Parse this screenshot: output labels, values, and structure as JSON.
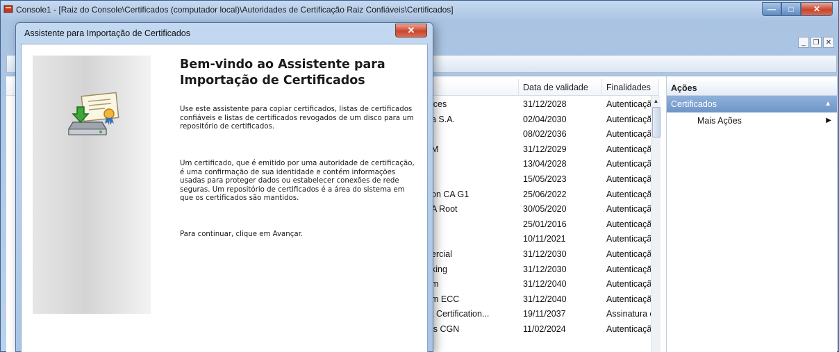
{
  "main_window": {
    "title": "Console1 - [Raiz do Console\\Certificados (computador local)\\Autoridades de Certificação Raiz Confiáveis\\Certificados]"
  },
  "list": {
    "columns": [
      "",
      "Data de validade",
      "Finalidades"
    ],
    "rows": [
      {
        "name": "ices",
        "date": "31/12/2028",
        "purpose": "Autenticaçã"
      },
      {
        "name": "a S.A.",
        "date": "02/04/2030",
        "purpose": "Autenticaçã"
      },
      {
        "name": "",
        "date": "08/02/2036",
        "purpose": "Autenticaçã"
      },
      {
        "name": "M",
        "date": "31/12/2029",
        "purpose": "Autenticaçã"
      },
      {
        "name": "",
        "date": "13/04/2028",
        "purpose": "Autenticaçã"
      },
      {
        "name": "",
        "date": "15/05/2023",
        "purpose": "Autenticaçã"
      },
      {
        "name": "on CA G1",
        "date": "25/06/2022",
        "purpose": "Autenticaçã"
      },
      {
        "name": "A Root",
        "date": "30/05/2020",
        "purpose": "Autenticaçã"
      },
      {
        "name": "",
        "date": "25/01/2016",
        "purpose": "Autenticaçã"
      },
      {
        "name": "",
        "date": "10/11/2021",
        "purpose": "Autenticaçã"
      },
      {
        "name": "ercial",
        "date": "31/12/2030",
        "purpose": "Autenticaçã"
      },
      {
        "name": "king",
        "date": "31/12/2030",
        "purpose": "Autenticaçã"
      },
      {
        "name": "m",
        "date": "31/12/2040",
        "purpose": "Autenticaçã"
      },
      {
        "name": "m ECC",
        "date": "31/12/2040",
        "purpose": "Autenticaçã"
      },
      {
        "name": "t Certification...",
        "date": "19/11/2037",
        "purpose": "Assinatura d"
      },
      {
        "name": "is CGN",
        "date": "11/02/2024",
        "purpose": "Autenticaçã"
      }
    ]
  },
  "actions": {
    "header": "Ações",
    "group": "Certificados",
    "more": "Mais Ações"
  },
  "wizard": {
    "title": "Assistente para Importação de Certificados",
    "heading": "Bem-vindo ao Assistente para Importação de Certificados",
    "paragraph1": "Use este assistente para copiar certificados, listas de certificados confiáveis e listas de certificados revogados de um disco para um repositório de certificados.",
    "paragraph2": "Um certificado, que é emitido por uma autoridade de certificação, é uma confirmação de sua identidade e contém informações usadas para proteger dados ou estabelecer conexões de rede seguras. Um repositório de certificados é a área do sistema em que os certificados são mantidos.",
    "paragraph3": "Para continuar, clique em Avançar."
  },
  "icons": [
    "mmc-app-icon",
    "certificate-import-icon",
    "close-icon",
    "minimize-icon",
    "maximize-icon",
    "scroll-up-icon",
    "collapse-arrow-icon",
    "submenu-arrow-icon"
  ]
}
